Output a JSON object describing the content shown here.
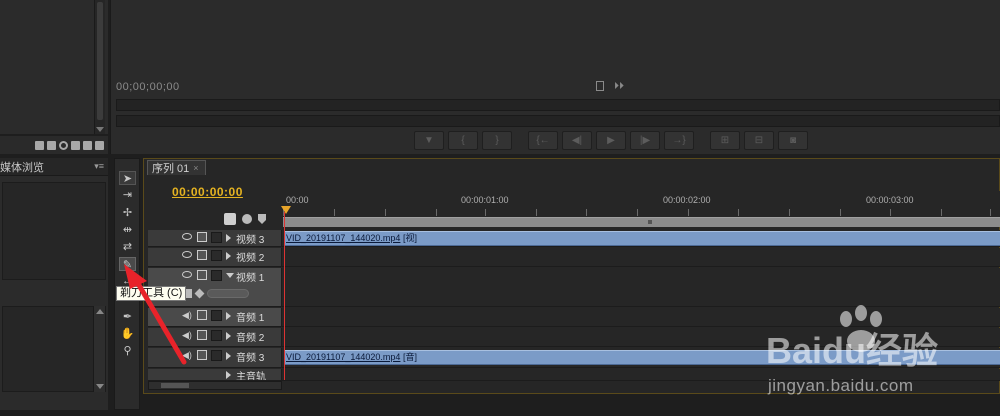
{
  "program_monitor": {
    "timecode": "00;00;00;00",
    "transport_buttons": [
      "marker",
      "in",
      "out",
      "goto-in",
      "step-back",
      "play",
      "step-forward",
      "goto-out",
      "insert",
      "overwrite",
      "export-frame"
    ]
  },
  "media_panel": {
    "tab_label": "媒体浏览",
    "menu_glyph": "▾≡"
  },
  "tooltip": {
    "text": "剃刀工具 (C)"
  },
  "timeline": {
    "sequence_tab": "序列 01",
    "close_glyph": "×",
    "timecode": "00:00:00:00",
    "ruler_labels": [
      "00:00",
      "00:00:01:00",
      "00:00:02:00",
      "00:00:03:00"
    ],
    "tracks": [
      {
        "name": "视频 3",
        "kind": "video"
      },
      {
        "name": "视频 2",
        "kind": "video"
      },
      {
        "name": "视频 1",
        "kind": "video"
      },
      {
        "name": "音频 1",
        "kind": "audio"
      },
      {
        "name": "音频 2",
        "kind": "audio"
      },
      {
        "name": "音频 3",
        "kind": "audio"
      },
      {
        "name": "主音轨",
        "kind": "master"
      }
    ],
    "clips": [
      {
        "file": "VID_20191107_144020.mp4",
        "tag": "[视]"
      },
      {
        "file": "VID_20191107_144020.mp4",
        "tag": "[音]"
      }
    ]
  },
  "watermark": {
    "brand": "Baidu经验",
    "url": "jingyan.baidu.com"
  },
  "colors": {
    "accent_timecode": "#e5b321",
    "clip_fill": "#7b9bc7",
    "playhead": "#dd3333",
    "annotation_arrow": "#e8232a"
  }
}
